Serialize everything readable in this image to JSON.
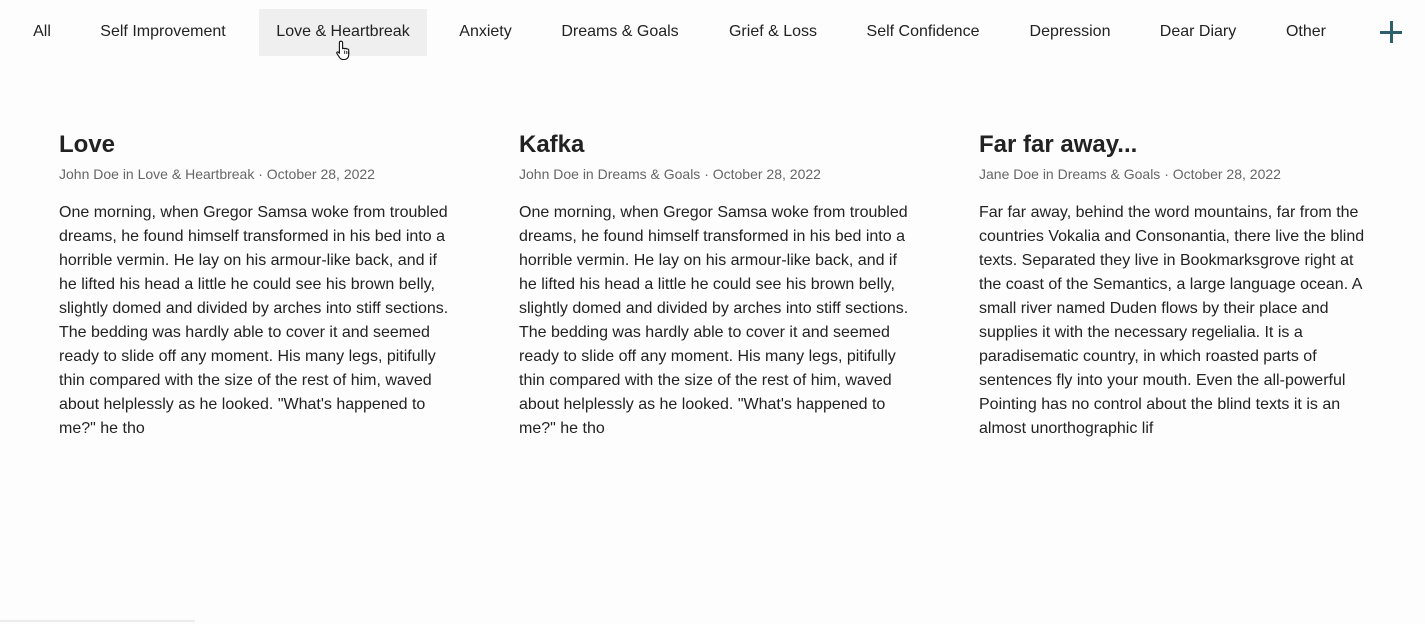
{
  "nav": {
    "tabs": [
      {
        "label": "All"
      },
      {
        "label": "Self Improvement"
      },
      {
        "label": "Love & Heartbreak",
        "active": true
      },
      {
        "label": "Anxiety"
      },
      {
        "label": "Dreams & Goals"
      },
      {
        "label": "Grief & Loss"
      },
      {
        "label": "Self Confidence"
      },
      {
        "label": "Depression"
      },
      {
        "label": "Dear Diary"
      },
      {
        "label": "Other"
      }
    ],
    "add_icon": "plus-icon",
    "accent_color": "#2e5f6c"
  },
  "posts": [
    {
      "title": "Love",
      "author": "John Doe",
      "category": "Love & Heartbreak",
      "date": "October 28, 2022",
      "meta": "John Doe in Love & Heartbreak · October 28, 2022",
      "excerpt": "One morning, when Gregor Samsa woke from troubled dreams, he found himself transformed in his bed into a horrible vermin. He lay on his armour-like back, and if he lifted his head a little he could see his brown belly, slightly domed and divided by arches into stiff sections. The bedding was hardly able to cover it and seemed ready to slide off any moment. His many legs, pitifully thin compared with the size of the rest of him, waved about helplessly as he looked. \"What's happened to me?\" he tho"
    },
    {
      "title": "Kafka",
      "author": "John Doe",
      "category": "Dreams & Goals",
      "date": "October 28, 2022",
      "meta": "John Doe in Dreams & Goals · October 28, 2022",
      "excerpt": "One morning, when Gregor Samsa woke from troubled dreams, he found himself transformed in his bed into a horrible vermin. He lay on his armour-like back, and if he lifted his head a little he could see his brown belly, slightly domed and divided by arches into stiff sections. The bedding was hardly able to cover it and seemed ready to slide off any moment. His many legs, pitifully thin compared with the size of the rest of him, waved about helplessly as he looked. \"What's happened to me?\" he tho"
    },
    {
      "title": "Far far away...",
      "author": "Jane Doe",
      "category": "Dreams & Goals",
      "date": "October 28, 2022",
      "meta": "Jane Doe in Dreams & Goals · October 28, 2022",
      "excerpt": "Far far away, behind the word mountains, far from the countries Vokalia and Consonantia, there live the blind texts. Separated they live in Bookmarksgrove right at the coast of the Semantics, a large language ocean. A small river named Duden flows by their place and supplies it with the necessary regelialia. It is a paradisematic country, in which roasted parts of sentences fly into your mouth. Even the all-powerful Pointing has no control about the blind texts it is an almost unorthographic lif"
    }
  ]
}
